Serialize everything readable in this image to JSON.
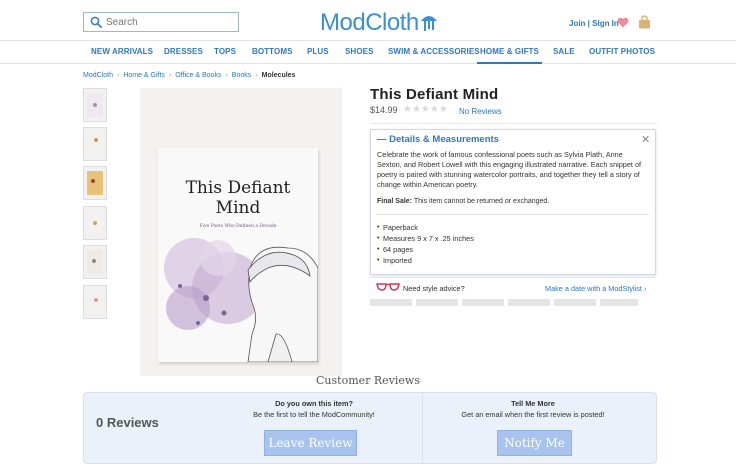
{
  "header": {
    "search_placeholder": "Search",
    "logo_text": "ModCloth",
    "account_link": "Join | Sign In"
  },
  "nav": {
    "items": [
      {
        "label": "NEW ARRIVALS"
      },
      {
        "label": "DRESSES"
      },
      {
        "label": "TOPS"
      },
      {
        "label": "BOTTOMS"
      },
      {
        "label": "PLUS"
      },
      {
        "label": "SHOES"
      },
      {
        "label": "SWIM & ACCESSORIES"
      },
      {
        "label": "HOME & GIFTS"
      },
      {
        "label": "SALE"
      },
      {
        "label": "OUTFIT PHOTOS"
      }
    ],
    "active": "HOME & GIFTS"
  },
  "breadcrumb": {
    "items": [
      "ModCloth",
      "Home & Gifts",
      "Office & Books",
      "Books"
    ],
    "current": "Molecules"
  },
  "product": {
    "title": "This Defiant Mind",
    "price": "$14.99",
    "reviews_link": "No Reviews",
    "rating_stars": 0,
    "image": {
      "book_title_line1": "This Defiant",
      "book_title_line2": "Mind",
      "book_subtitle": "Five Poets Who Defined a Decade"
    }
  },
  "details": {
    "header": "Details & Measurements",
    "toggle_symbol": "—",
    "close_symbol": "✕",
    "description": "Celebrate the work of famous confessional poets such as Sylvia Plath, Anne Sexton, and Robert Lowell with this engaging illustrated narrative. Each snippet of poetry is paired with stunning watercolor portraits, and together they tell a story of change within American poetry.",
    "final_sale_label": "Final Sale:",
    "final_sale_text": "This item cannot be returned or exchanged.",
    "specs": [
      "Paperback",
      "Measures 9 x 7 x .25 inches",
      "64 pages",
      "Imported"
    ]
  },
  "advice": {
    "text": "Need style advice?",
    "link": "Make a date with a ModStylist ›"
  },
  "reviews": {
    "heading": "Customer Reviews",
    "count_text": "0 Reviews",
    "own_question": "Do you own this item?",
    "own_subtext": "Be the first to tell the ModCommunity!",
    "leave_button": "Leave Review",
    "tell_question": "Tell Me More",
    "tell_subtext": "Get an email when the first review is posted!",
    "notify_button": "Notify Me"
  },
  "colors": {
    "accent": "#2e77c2",
    "button": "#a7c3ee",
    "review_box": "#ebf1fa"
  }
}
